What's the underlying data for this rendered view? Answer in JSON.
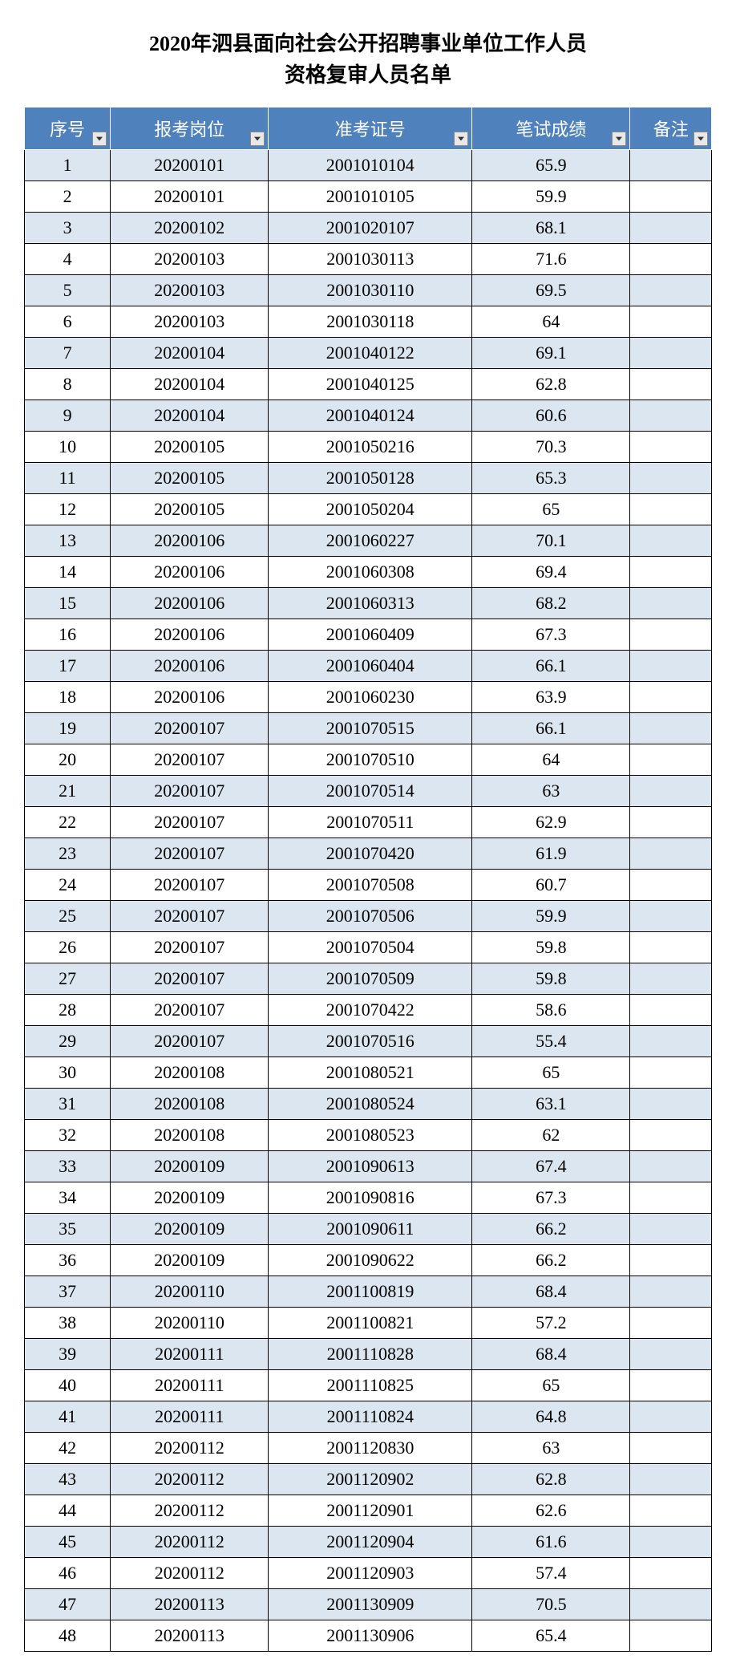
{
  "title_line1": "2020年泗县面向社会公开招聘事业单位工作人员",
  "title_line2": "资格复审人员名单",
  "headers": {
    "seq": "序号",
    "position": "报考岗位",
    "exam_no": "准考证号",
    "score": "笔试成绩",
    "note": "备注"
  },
  "rows": [
    {
      "seq": "1",
      "position": "20200101",
      "exam_no": "2001010104",
      "score": "65.9",
      "note": ""
    },
    {
      "seq": "2",
      "position": "20200101",
      "exam_no": "2001010105",
      "score": "59.9",
      "note": ""
    },
    {
      "seq": "3",
      "position": "20200102",
      "exam_no": "2001020107",
      "score": "68.1",
      "note": ""
    },
    {
      "seq": "4",
      "position": "20200103",
      "exam_no": "2001030113",
      "score": "71.6",
      "note": ""
    },
    {
      "seq": "5",
      "position": "20200103",
      "exam_no": "2001030110",
      "score": "69.5",
      "note": ""
    },
    {
      "seq": "6",
      "position": "20200103",
      "exam_no": "2001030118",
      "score": "64",
      "note": ""
    },
    {
      "seq": "7",
      "position": "20200104",
      "exam_no": "2001040122",
      "score": "69.1",
      "note": ""
    },
    {
      "seq": "8",
      "position": "20200104",
      "exam_no": "2001040125",
      "score": "62.8",
      "note": ""
    },
    {
      "seq": "9",
      "position": "20200104",
      "exam_no": "2001040124",
      "score": "60.6",
      "note": ""
    },
    {
      "seq": "10",
      "position": "20200105",
      "exam_no": "2001050216",
      "score": "70.3",
      "note": ""
    },
    {
      "seq": "11",
      "position": "20200105",
      "exam_no": "2001050128",
      "score": "65.3",
      "note": ""
    },
    {
      "seq": "12",
      "position": "20200105",
      "exam_no": "2001050204",
      "score": "65",
      "note": ""
    },
    {
      "seq": "13",
      "position": "20200106",
      "exam_no": "2001060227",
      "score": "70.1",
      "note": ""
    },
    {
      "seq": "14",
      "position": "20200106",
      "exam_no": "2001060308",
      "score": "69.4",
      "note": ""
    },
    {
      "seq": "15",
      "position": "20200106",
      "exam_no": "2001060313",
      "score": "68.2",
      "note": ""
    },
    {
      "seq": "16",
      "position": "20200106",
      "exam_no": "2001060409",
      "score": "67.3",
      "note": ""
    },
    {
      "seq": "17",
      "position": "20200106",
      "exam_no": "2001060404",
      "score": "66.1",
      "note": ""
    },
    {
      "seq": "18",
      "position": "20200106",
      "exam_no": "2001060230",
      "score": "63.9",
      "note": ""
    },
    {
      "seq": "19",
      "position": "20200107",
      "exam_no": "2001070515",
      "score": "66.1",
      "note": ""
    },
    {
      "seq": "20",
      "position": "20200107",
      "exam_no": "2001070510",
      "score": "64",
      "note": ""
    },
    {
      "seq": "21",
      "position": "20200107",
      "exam_no": "2001070514",
      "score": "63",
      "note": ""
    },
    {
      "seq": "22",
      "position": "20200107",
      "exam_no": "2001070511",
      "score": "62.9",
      "note": ""
    },
    {
      "seq": "23",
      "position": "20200107",
      "exam_no": "2001070420",
      "score": "61.9",
      "note": ""
    },
    {
      "seq": "24",
      "position": "20200107",
      "exam_no": "2001070508",
      "score": "60.7",
      "note": ""
    },
    {
      "seq": "25",
      "position": "20200107",
      "exam_no": "2001070506",
      "score": "59.9",
      "note": ""
    },
    {
      "seq": "26",
      "position": "20200107",
      "exam_no": "2001070504",
      "score": "59.8",
      "note": ""
    },
    {
      "seq": "27",
      "position": "20200107",
      "exam_no": "2001070509",
      "score": "59.8",
      "note": ""
    },
    {
      "seq": "28",
      "position": "20200107",
      "exam_no": "2001070422",
      "score": "58.6",
      "note": ""
    },
    {
      "seq": "29",
      "position": "20200107",
      "exam_no": "2001070516",
      "score": "55.4",
      "note": ""
    },
    {
      "seq": "30",
      "position": "20200108",
      "exam_no": "2001080521",
      "score": "65",
      "note": ""
    },
    {
      "seq": "31",
      "position": "20200108",
      "exam_no": "2001080524",
      "score": "63.1",
      "note": ""
    },
    {
      "seq": "32",
      "position": "20200108",
      "exam_no": "2001080523",
      "score": "62",
      "note": ""
    },
    {
      "seq": "33",
      "position": "20200109",
      "exam_no": "2001090613",
      "score": "67.4",
      "note": ""
    },
    {
      "seq": "34",
      "position": "20200109",
      "exam_no": "2001090816",
      "score": "67.3",
      "note": ""
    },
    {
      "seq": "35",
      "position": "20200109",
      "exam_no": "2001090611",
      "score": "66.2",
      "note": ""
    },
    {
      "seq": "36",
      "position": "20200109",
      "exam_no": "2001090622",
      "score": "66.2",
      "note": ""
    },
    {
      "seq": "37",
      "position": "20200110",
      "exam_no": "2001100819",
      "score": "68.4",
      "note": ""
    },
    {
      "seq": "38",
      "position": "20200110",
      "exam_no": "2001100821",
      "score": "57.2",
      "note": ""
    },
    {
      "seq": "39",
      "position": "20200111",
      "exam_no": "2001110828",
      "score": "68.4",
      "note": ""
    },
    {
      "seq": "40",
      "position": "20200111",
      "exam_no": "2001110825",
      "score": "65",
      "note": ""
    },
    {
      "seq": "41",
      "position": "20200111",
      "exam_no": "2001110824",
      "score": "64.8",
      "note": ""
    },
    {
      "seq": "42",
      "position": "20200112",
      "exam_no": "2001120830",
      "score": "63",
      "note": ""
    },
    {
      "seq": "43",
      "position": "20200112",
      "exam_no": "2001120902",
      "score": "62.8",
      "note": ""
    },
    {
      "seq": "44",
      "position": "20200112",
      "exam_no": "2001120901",
      "score": "62.6",
      "note": ""
    },
    {
      "seq": "45",
      "position": "20200112",
      "exam_no": "2001120904",
      "score": "61.6",
      "note": ""
    },
    {
      "seq": "46",
      "position": "20200112",
      "exam_no": "2001120903",
      "score": "57.4",
      "note": ""
    },
    {
      "seq": "47",
      "position": "20200113",
      "exam_no": "2001130909",
      "score": "70.5",
      "note": ""
    },
    {
      "seq": "48",
      "position": "20200113",
      "exam_no": "2001130906",
      "score": "65.4",
      "note": ""
    }
  ]
}
